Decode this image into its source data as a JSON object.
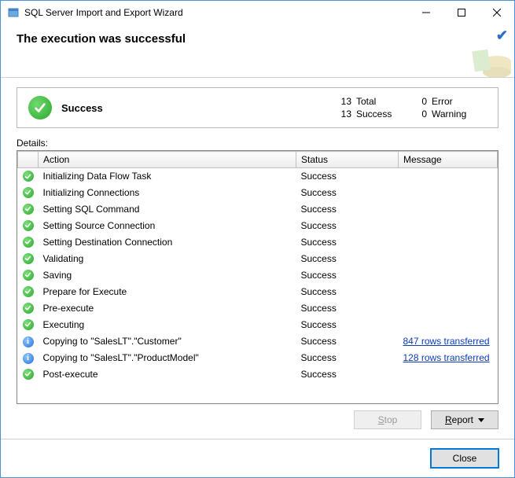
{
  "window": {
    "title": "SQL Server Import and Export Wizard"
  },
  "header": {
    "title": "The execution was successful"
  },
  "summary": {
    "label": "Success",
    "stats": {
      "total_n": "13",
      "total_label": "Total",
      "error_n": "0",
      "error_label": "Error",
      "success_n": "13",
      "success_label": "Success",
      "warning_n": "0",
      "warning_label": "Warning"
    }
  },
  "details_label": "Details:",
  "columns": {
    "action": "Action",
    "status": "Status",
    "message": "Message"
  },
  "rows": [
    {
      "icon": "success",
      "action": "Initializing Data Flow Task",
      "status": "Success",
      "message": ""
    },
    {
      "icon": "success",
      "action": "Initializing Connections",
      "status": "Success",
      "message": ""
    },
    {
      "icon": "success",
      "action": "Setting SQL Command",
      "status": "Success",
      "message": ""
    },
    {
      "icon": "success",
      "action": "Setting Source Connection",
      "status": "Success",
      "message": ""
    },
    {
      "icon": "success",
      "action": "Setting Destination Connection",
      "status": "Success",
      "message": ""
    },
    {
      "icon": "success",
      "action": "Validating",
      "status": "Success",
      "message": ""
    },
    {
      "icon": "success",
      "action": "Saving",
      "status": "Success",
      "message": ""
    },
    {
      "icon": "success",
      "action": "Prepare for Execute",
      "status": "Success",
      "message": ""
    },
    {
      "icon": "success",
      "action": "Pre-execute",
      "status": "Success",
      "message": ""
    },
    {
      "icon": "success",
      "action": "Executing",
      "status": "Success",
      "message": ""
    },
    {
      "icon": "info",
      "action": "Copying to \"SalesLT\".\"Customer\"",
      "status": "Success",
      "message": "847 rows transferred",
      "link": true
    },
    {
      "icon": "info",
      "action": "Copying to \"SalesLT\".\"ProductModel\"",
      "status": "Success",
      "message": "128 rows transferred",
      "link": true
    },
    {
      "icon": "success",
      "action": "Post-execute",
      "status": "Success",
      "message": ""
    }
  ],
  "buttons": {
    "stop": "Stop",
    "report": "Report",
    "close": "Close"
  }
}
